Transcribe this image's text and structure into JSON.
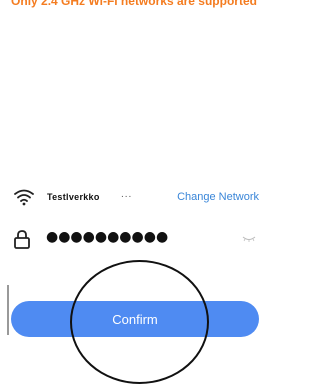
{
  "notice": "Only 2.4 GHz Wi-Fi networks are supported",
  "wifi": {
    "icon": "wifi-icon",
    "ssid": "Testlverkko",
    "more": "...",
    "change_label": "Change Network"
  },
  "password": {
    "icon": "lock-icon",
    "masked_value": "●●●●●●●●●●",
    "toggle_icon": "eye-closed-icon"
  },
  "confirm_label": "Confirm",
  "colors": {
    "notice": "#f47c20",
    "link": "#3a86d8",
    "button": "#4f8bf2",
    "button_text": "#ffffff"
  }
}
